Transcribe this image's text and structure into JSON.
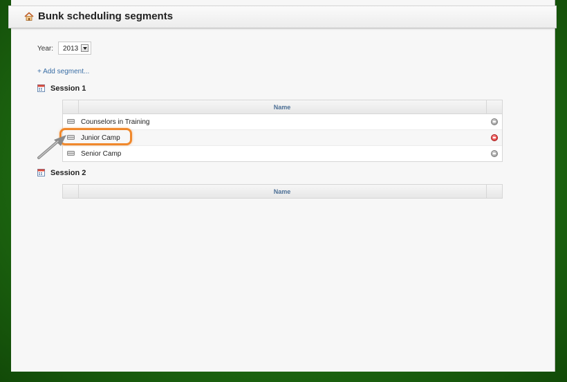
{
  "header": {
    "title": "Bunk scheduling segments",
    "icon": "home-icon"
  },
  "filters": {
    "year_label": "Year:",
    "year_value": "2013"
  },
  "actions": {
    "add_segment": "+ Add segment..."
  },
  "sessions": [
    {
      "label": "Session 1",
      "column_header": "Name",
      "rows": [
        {
          "name": "Counselors in Training",
          "delete_state": "normal"
        },
        {
          "name": "Junior Camp",
          "delete_state": "hover"
        },
        {
          "name": "Senior Camp",
          "delete_state": "normal"
        }
      ]
    },
    {
      "label": "Session 2",
      "column_header": "Name",
      "rows": []
    }
  ],
  "colors": {
    "highlight": "#f0882b",
    "link": "#3a6ea5",
    "delete_active": "#d92b2b"
  }
}
